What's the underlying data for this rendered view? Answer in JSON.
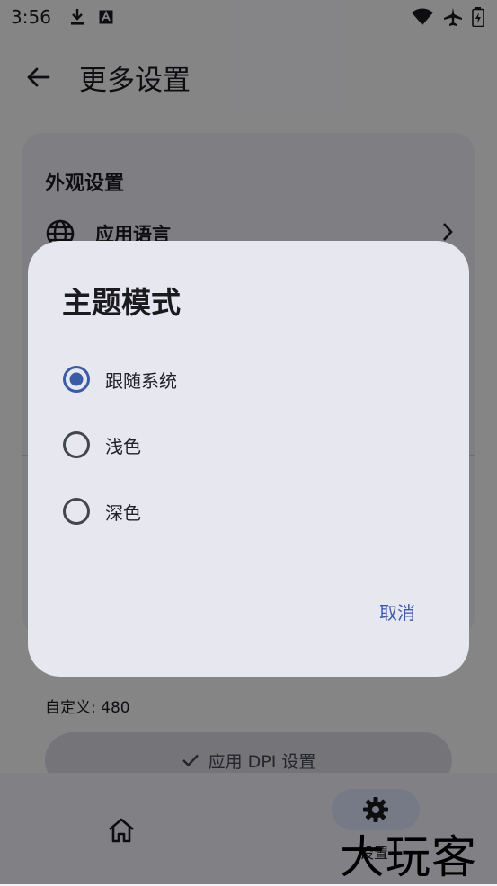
{
  "status_bar": {
    "time": "3:56"
  },
  "app_bar": {
    "title": "更多设置"
  },
  "appearance": {
    "section_title": "外观设置",
    "language_row_label": "应用语言"
  },
  "dpi": {
    "custom_value": "自定义: 480",
    "apply_button_label": "应用 DPI 设置"
  },
  "bottom_nav": {
    "settings_label": "设置"
  },
  "watermark_text": "大玩客",
  "dialog": {
    "title": "主题模式",
    "options": [
      {
        "label": "跟随系统",
        "selected": true
      },
      {
        "label": "浅色",
        "selected": false
      },
      {
        "label": "深色",
        "selected": false
      }
    ],
    "cancel_label": "取消"
  },
  "colors": {
    "accent": "#3c5ba5",
    "radio_outline": "#44464f"
  }
}
